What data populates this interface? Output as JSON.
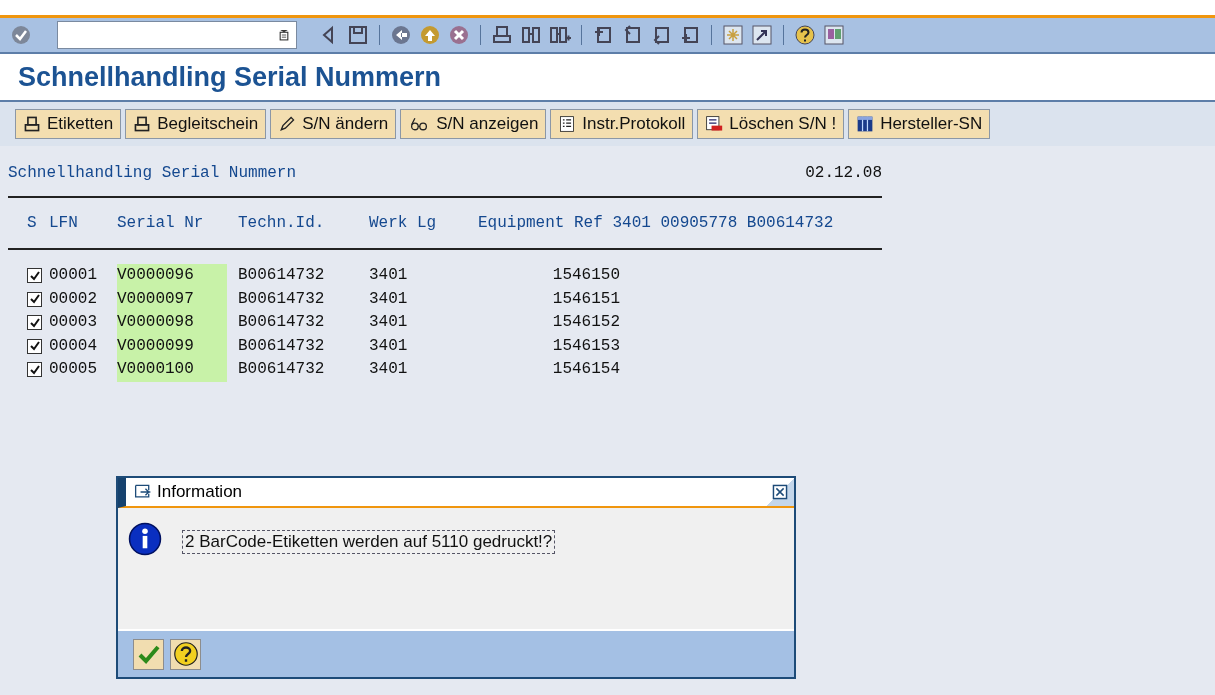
{
  "title": "Schnellhandling Serial Nummern",
  "app_buttons": [
    {
      "label": "Etiketten"
    },
    {
      "label": "Begleitschein"
    },
    {
      "label": "S/N ändern"
    },
    {
      "label": "S/N anzeigen"
    },
    {
      "label": "Instr.Protokoll"
    },
    {
      "label": "Löschen S/N !"
    },
    {
      "label": "Hersteller-SN"
    }
  ],
  "report": {
    "heading": "Schnellhandling Serial Nummern",
    "date": "02.12.08",
    "columns": [
      "S",
      "LFN",
      "Serial Nr",
      "Techn.Id.",
      "Werk Lg",
      "Equipment Ref 3401 00905778 B00614732"
    ],
    "rows": [
      {
        "checked": true,
        "lfn": "00001",
        "serial": "V0000096",
        "techn_id": "B00614732",
        "werk": "3401",
        "equipment": "1546150"
      },
      {
        "checked": true,
        "lfn": "00002",
        "serial": "V0000097",
        "techn_id": "B00614732",
        "werk": "3401",
        "equipment": "1546151"
      },
      {
        "checked": true,
        "lfn": "00003",
        "serial": "V0000098",
        "techn_id": "B00614732",
        "werk": "3401",
        "equipment": "1546152"
      },
      {
        "checked": true,
        "lfn": "00004",
        "serial": "V0000099",
        "techn_id": "B00614732",
        "werk": "3401",
        "equipment": "1546153"
      },
      {
        "checked": true,
        "lfn": "00005",
        "serial": "V0000100",
        "techn_id": "B00614732",
        "werk": "3401",
        "equipment": "1546154"
      }
    ]
  },
  "dialog": {
    "title": "Information",
    "message": "2 BarCode-Etiketten werden auf 5110 gedruckt!?"
  }
}
